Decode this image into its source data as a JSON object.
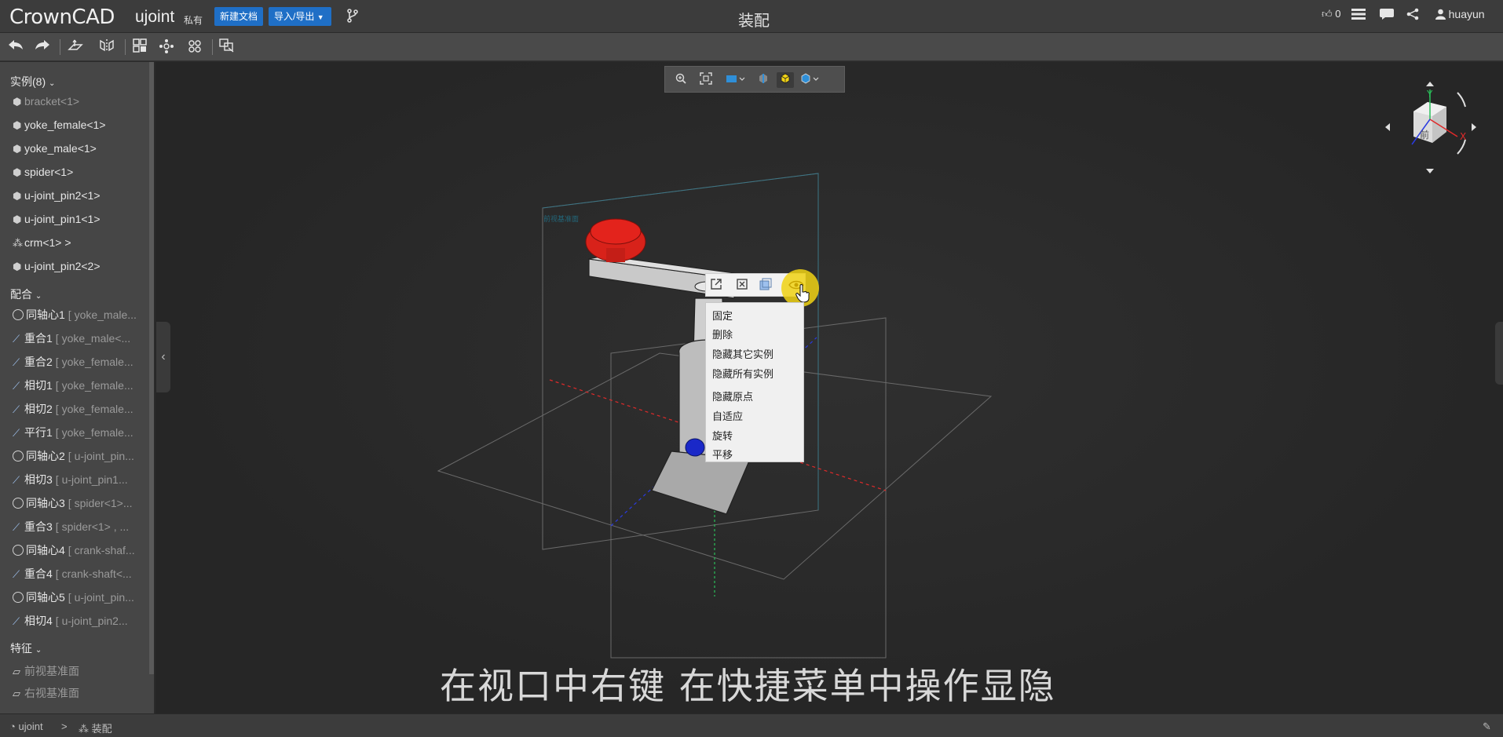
{
  "header": {
    "logo": "CrownCAD",
    "doc_name": "ujoint",
    "privacy": "私有",
    "new_doc_label": "新建文档",
    "import_export_label": "导入/导出",
    "center_title": "装配",
    "like_count": "0",
    "username": "huayun"
  },
  "sidebar": {
    "instances_header": "实例(8)",
    "instances": [
      {
        "label": "bracket<1>"
      },
      {
        "label": "yoke_female<1>"
      },
      {
        "label": "yoke_male<1>"
      },
      {
        "label": "spider<1>"
      },
      {
        "label": "u-joint_pin2<1>"
      },
      {
        "label": "u-joint_pin1<1>"
      },
      {
        "label": "crm<1>",
        "suffix": ">"
      },
      {
        "label": "u-joint_pin2<2>"
      }
    ],
    "mates_header": "配合",
    "mates": [
      {
        "type": "ring",
        "name": "同轴心1",
        "detail": "[ yoke_male..."
      },
      {
        "type": "slash",
        "name": "重合1",
        "detail": "[ yoke_male<..."
      },
      {
        "type": "slash",
        "name": "重合2",
        "detail": "[ yoke_female..."
      },
      {
        "type": "slash",
        "name": "相切1",
        "detail": "[ yoke_female..."
      },
      {
        "type": "slash",
        "name": "相切2",
        "detail": "[ yoke_female..."
      },
      {
        "type": "slash",
        "name": "平行1",
        "detail": "[ yoke_female..."
      },
      {
        "type": "ring",
        "name": "同轴心2",
        "detail": "[ u-joint_pin..."
      },
      {
        "type": "slash",
        "name": "相切3",
        "detail": "[ u-joint_pin1..."
      },
      {
        "type": "ring",
        "name": "同轴心3",
        "detail": "[ spider<1>..."
      },
      {
        "type": "slash",
        "name": "重合3",
        "detail": "[ spider<1> , ..."
      },
      {
        "type": "ring",
        "name": "同轴心4",
        "detail": "[ crank-shaf..."
      },
      {
        "type": "slash",
        "name": "重合4",
        "detail": "[ crank-shaft<..."
      },
      {
        "type": "ring",
        "name": "同轴心5",
        "detail": "[ u-joint_pin..."
      },
      {
        "type": "slash",
        "name": "相切4",
        "detail": "[ u-joint_pin2..."
      }
    ],
    "features_header": "特征",
    "features": [
      {
        "label": "前视基准面"
      },
      {
        "label": "右视基准面"
      }
    ]
  },
  "context_menu": {
    "items": [
      "固定",
      "删除",
      "隐藏其它实例",
      "隐藏所有实例",
      "隐藏原点",
      "自适应",
      "旋转",
      "平移"
    ]
  },
  "viewcube": {
    "face_label": "前",
    "axis_y": "Y",
    "axis_x": "X"
  },
  "subtitle": "在视口中右键  在快捷菜单中操作显隐",
  "statusbar": {
    "crumb_doc": "ujoint",
    "crumb_sep": ">",
    "crumb_assembly": "装配"
  },
  "colors": {
    "accent_blue": "#1f6fc6",
    "part_red": "#e3231c",
    "highlight_yellow": "#f0d214"
  }
}
